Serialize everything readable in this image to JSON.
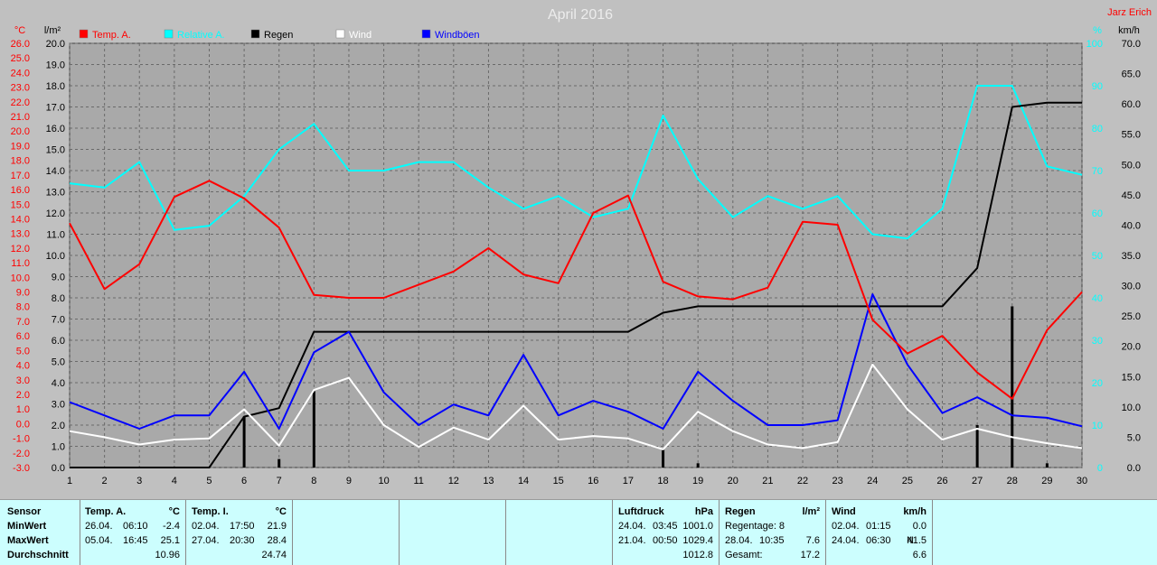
{
  "chart_data": {
    "type": "line",
    "title": "April 2016",
    "author": "Jarz Erich",
    "legend": [
      {
        "name": "Temp. A.",
        "color": "#ff0000"
      },
      {
        "name": "Relative A.",
        "color": "#00ffff"
      },
      {
        "name": "Regen",
        "color": "#000000"
      },
      {
        "name": "Wind",
        "color": "#ffffff"
      },
      {
        "name": "Windböen",
        "color": "#0000ff"
      }
    ],
    "axes": {
      "x_ticks": [
        1,
        2,
        3,
        4,
        5,
        6,
        7,
        8,
        9,
        10,
        11,
        12,
        13,
        14,
        15,
        16,
        17,
        18,
        19,
        20,
        21,
        22,
        23,
        24,
        25,
        26,
        27,
        28,
        29,
        30
      ],
      "temp_unit": "°C",
      "temp_ticks": [
        "26.0",
        "25.0",
        "24.0",
        "23.0",
        "22.0",
        "21.0",
        "20.0",
        "19.0",
        "18.0",
        "17.0",
        "16.0",
        "15.0",
        "14.0",
        "13.0",
        "12.0",
        "11.0",
        "10.0",
        "9.0",
        "8.0",
        "7.0",
        "6.0",
        "5.0",
        "4.0",
        "3.0",
        "2.0",
        "1.0",
        "0.0",
        "-1.0",
        "-2.0",
        "-3.0"
      ],
      "temp_range": [
        -3,
        26
      ],
      "rain_unit": "l/m²",
      "rain_ticks": [
        "20.0",
        "19.0",
        "18.0",
        "17.0",
        "16.0",
        "15.0",
        "14.0",
        "13.0",
        "12.0",
        "11.0",
        "10.0",
        "9.0",
        "8.0",
        "7.0",
        "6.0",
        "5.0",
        "4.0",
        "3.0",
        "2.0",
        "1.0",
        "0.0"
      ],
      "rain_range": [
        0,
        20
      ],
      "hum_unit": "%",
      "hum_ticks": [
        "100",
        "90",
        "80",
        "70",
        "60",
        "50",
        "40",
        "30",
        "20",
        "10",
        "0"
      ],
      "hum_range": [
        0,
        100
      ],
      "wind_unit": "km/h",
      "wind_ticks": [
        "70.0",
        "65.0",
        "60.0",
        "55.0",
        "50.0",
        "45.0",
        "40.0",
        "35.0",
        "30.0",
        "25.0",
        "20.0",
        "15.0",
        "10.0",
        "5.0",
        "0.0"
      ],
      "wind_range": [
        0,
        70
      ]
    },
    "series": [
      {
        "name": "Temp. A.",
        "axis": "temp",
        "color": "#ff0000",
        "x": [
          1,
          2,
          3,
          4,
          5,
          6,
          7,
          8,
          9,
          10,
          11,
          12,
          13,
          14,
          15,
          16,
          17,
          18,
          19,
          20,
          21,
          22,
          23,
          24,
          25,
          26,
          27,
          28,
          29,
          30
        ],
        "values": [
          13.7,
          9.2,
          10.9,
          15.5,
          16.6,
          15.4,
          13.4,
          8.8,
          8.6,
          8.6,
          9.5,
          10.4,
          12.0,
          10.2,
          9.6,
          14.4,
          15.6,
          9.7,
          8.7,
          8.5,
          9.3,
          13.8,
          13.6,
          7.1,
          4.8,
          6.0,
          3.5,
          1.7,
          6.4,
          9.0
        ]
      },
      {
        "name": "Relative A.",
        "axis": "hum",
        "color": "#00ffff",
        "x": [
          1,
          2,
          3,
          4,
          5,
          6,
          7,
          8,
          9,
          10,
          11,
          12,
          13,
          14,
          15,
          16,
          17,
          18,
          19,
          20,
          21,
          22,
          23,
          24,
          25,
          26,
          27,
          28,
          29,
          30
        ],
        "values": [
          67,
          66,
          72,
          56,
          57,
          64,
          75,
          81,
          70,
          70,
          72,
          72,
          66,
          61,
          64,
          59,
          61,
          83,
          68,
          59,
          64,
          61,
          64,
          55,
          54,
          61,
          90,
          90,
          71,
          69
        ]
      },
      {
        "name": "Regen",
        "axis": "rain",
        "color": "#000000",
        "x": [
          1,
          2,
          3,
          4,
          5,
          6,
          7,
          8,
          9,
          10,
          11,
          12,
          13,
          14,
          15,
          16,
          17,
          18,
          19,
          20,
          21,
          22,
          23,
          24,
          25,
          26,
          27,
          28,
          29,
          30
        ],
        "values": [
          0,
          0,
          0,
          0,
          0,
          2.4,
          2.8,
          6.4,
          6.4,
          6.4,
          6.4,
          6.4,
          6.4,
          6.4,
          6.4,
          6.4,
          6.4,
          7.3,
          7.6,
          7.6,
          7.6,
          7.6,
          7.6,
          7.6,
          7.6,
          7.6,
          9.4,
          17.0,
          17.2,
          17.2
        ]
      },
      {
        "name": "Wind",
        "axis": "wind",
        "color": "#ffffff",
        "x": [
          1,
          2,
          3,
          4,
          5,
          6,
          7,
          8,
          9,
          10,
          11,
          12,
          13,
          14,
          15,
          16,
          17,
          18,
          19,
          20,
          21,
          22,
          23,
          24,
          25,
          26,
          27,
          28,
          29,
          30
        ],
        "values": [
          6.0,
          5.0,
          3.8,
          4.6,
          4.8,
          9.6,
          3.6,
          12.8,
          14.8,
          7.0,
          3.4,
          6.6,
          4.6,
          10.2,
          4.6,
          5.2,
          4.8,
          3.0,
          9.2,
          6.0,
          3.8,
          3.2,
          4.2,
          17.0,
          9.6,
          4.6,
          6.4,
          5.0,
          4.0,
          3.2
        ]
      },
      {
        "name": "Windböen",
        "axis": "wind",
        "color": "#0000ff",
        "x": [
          1,
          2,
          3,
          4,
          5,
          6,
          7,
          8,
          9,
          10,
          11,
          12,
          13,
          14,
          15,
          16,
          17,
          18,
          19,
          20,
          21,
          22,
          23,
          24,
          25,
          26,
          27,
          28,
          29,
          30
        ],
        "values": [
          10.8,
          8.6,
          6.4,
          8.6,
          8.6,
          15.8,
          6.4,
          19.0,
          22.4,
          12.4,
          7.0,
          10.4,
          8.6,
          18.6,
          8.6,
          11.0,
          9.2,
          6.4,
          15.8,
          11.0,
          7.0,
          7.0,
          7.8,
          28.6,
          17.0,
          9.0,
          11.6,
          8.6,
          8.2,
          6.8
        ]
      },
      {
        "name": "Regen (daily)",
        "axis": "rain",
        "color": "#000000",
        "type": "bar",
        "x": [
          6,
          7,
          8,
          18,
          19,
          27,
          28,
          29
        ],
        "values": [
          2.4,
          0.4,
          3.6,
          0.9,
          0.2,
          2.0,
          7.6,
          0.2
        ]
      }
    ]
  },
  "table": {
    "sensor": {
      "header": "Sensor",
      "min": "MinWert",
      "max": "MaxWert",
      "avg": "Durchschnitt"
    },
    "tempA": {
      "header": "Temp. A.",
      "unit": "°C",
      "min_date": "26.04.",
      "min_time": "06:10",
      "min_val": "-2.4",
      "max_date": "05.04.",
      "max_time": "16:45",
      "max_val": "25.1",
      "avg": "10.96"
    },
    "tempI": {
      "header": "Temp. I.",
      "unit": "°C",
      "min_date": "02.04.",
      "min_time": "17:50",
      "min_val": "21.9",
      "max_date": "27.04.",
      "max_time": "20:30",
      "max_val": "28.4",
      "avg": "24.74"
    },
    "pressure": {
      "header": "Luftdruck",
      "unit": "hPa",
      "min_date": "24.04.",
      "min_time": "03:45",
      "min_val": "1001.0",
      "max_date": "21.04.",
      "max_time": "00:50",
      "max_val": "1029.4",
      "avg": "1012.8"
    },
    "rain": {
      "header": "Regen",
      "unit": "l/m²",
      "row1": "Regentage: 8",
      "row2_date": "28.04.",
      "row2_time": "10:35",
      "row2_val": "7.6",
      "row3": "Gesamt:",
      "row3_val": "17.2"
    },
    "wind": {
      "header": "Wind",
      "unit": "km/h",
      "min_date": "02.04.",
      "min_time": "01:15",
      "min_val": "0.0",
      "max_date": "24.04.",
      "max_time": "06:30",
      "max_dir": "N",
      "max_val": "41.5",
      "avg": "6.6"
    }
  }
}
